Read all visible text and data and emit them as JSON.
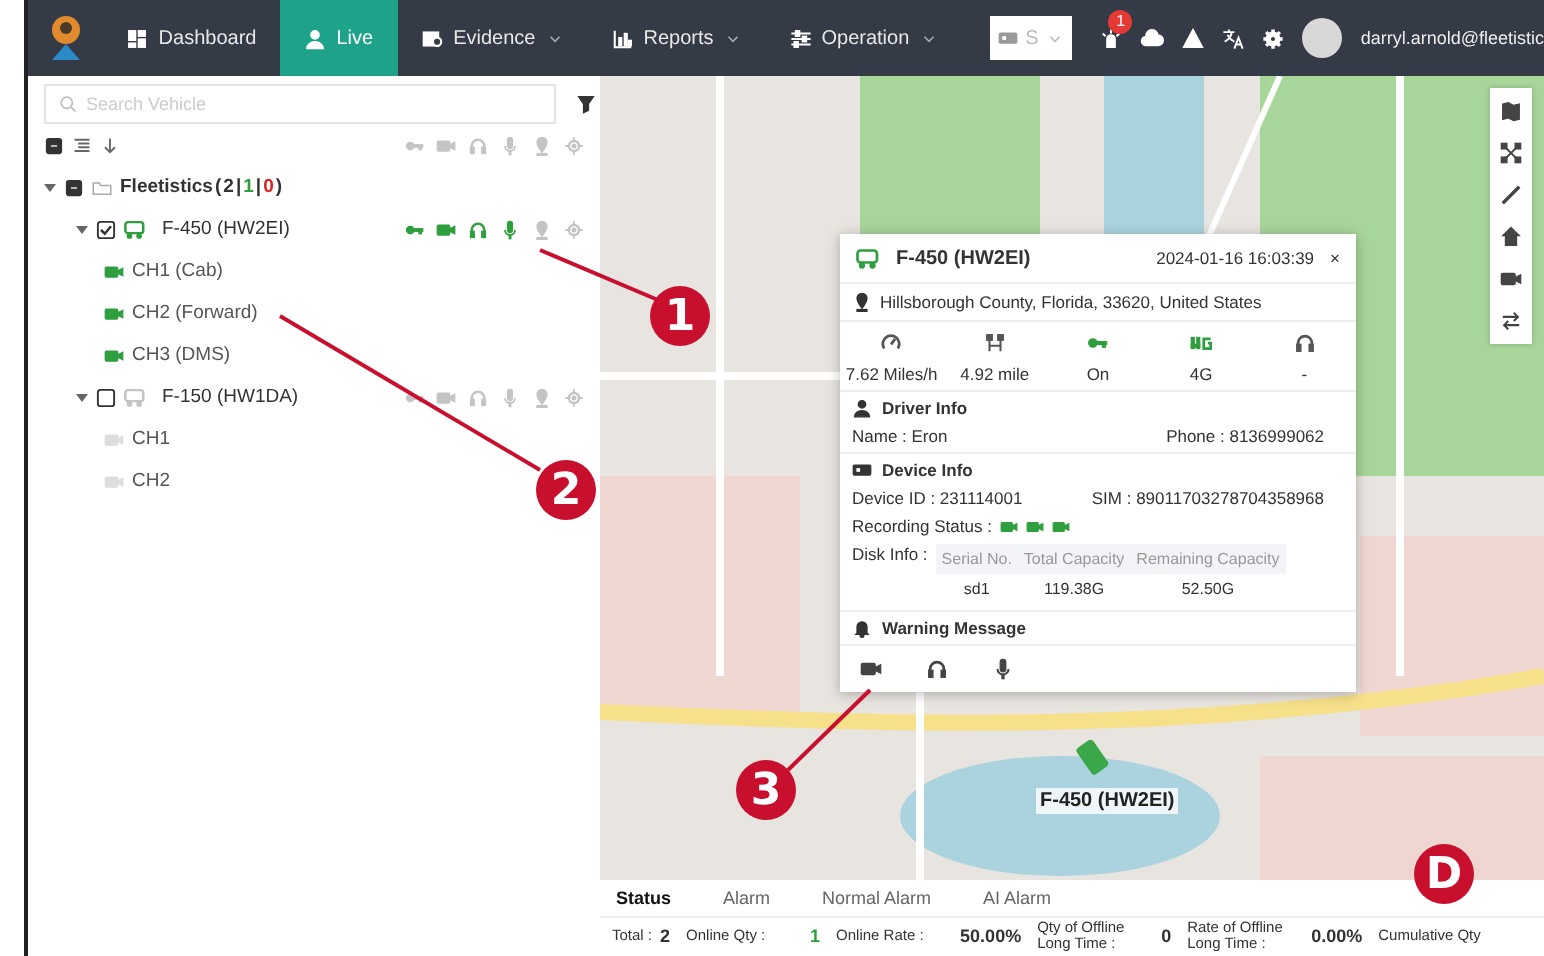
{
  "nav": {
    "items": [
      {
        "label": "Dashboard",
        "selected": false,
        "dropdown": false
      },
      {
        "label": "Live",
        "selected": true,
        "dropdown": false
      },
      {
        "label": "Evidence",
        "selected": false,
        "dropdown": true
      },
      {
        "label": "Reports",
        "selected": false,
        "dropdown": true
      },
      {
        "label": "Operation",
        "selected": false,
        "dropdown": true
      }
    ],
    "select_value": "S",
    "notification_count": "1",
    "user": "darryl.arnold@fleetistic"
  },
  "sidebar": {
    "search": {
      "placeholder": "Search Vehicle"
    },
    "group": {
      "label": "Fleetistics",
      "expanded": true,
      "indeterminate": true,
      "count_parts": [
        {
          "text": "(",
          "color": "#333333"
        },
        {
          "text": "2",
          "color": "#333333"
        },
        {
          "text": "|",
          "color": "#333333"
        },
        {
          "text": "1",
          "color": "#2e9e3e"
        },
        {
          "text": "|",
          "color": "#333333"
        },
        {
          "text": "0",
          "color": "#e02020"
        },
        {
          "text": ")",
          "color": "#333333"
        }
      ],
      "vehicles": [
        {
          "name": "F-450 (HW2EI)",
          "online": true,
          "checked": true,
          "expanded": true,
          "channels": [
            {
              "label": "CH1 (Cab)",
              "online": true
            },
            {
              "label": "CH2 (Forward)",
              "online": true
            },
            {
              "label": "CH3 (DMS)",
              "online": true
            }
          ]
        },
        {
          "name": "F-150 (HW1DA)",
          "online": false,
          "checked": false,
          "expanded": true,
          "channels": [
            {
              "label": "CH1",
              "online": false
            },
            {
              "label": "CH2",
              "online": false
            }
          ]
        }
      ]
    }
  },
  "popup": {
    "title": "F-450 (HW2EI)",
    "time": "2024-01-16 16:03:39",
    "close": "×",
    "address": "Hillsborough County, Florida, 33620, United States",
    "stats": [
      {
        "value": "7.62 Miles/h",
        "active": false
      },
      {
        "value": "4.92 mile",
        "active": false
      },
      {
        "value": "On",
        "active": true
      },
      {
        "value": "4G",
        "active": true
      },
      {
        "value": "-",
        "active": false
      }
    ],
    "driver": {
      "heading": "Driver Info",
      "name": "Name : Eron",
      "phone": "Phone : 8136999062"
    },
    "device": {
      "heading": "Device Info",
      "id": "Device ID : 231114001",
      "sim": "SIM : 89011703278704358968",
      "recording_label": "Recording Status :",
      "recording": [
        {
          "on": true
        },
        {
          "on": true
        },
        {
          "on": true
        }
      ],
      "disk_label": "Disk Info :",
      "disk_columns": [
        "Serial No.",
        "Total Capacity",
        "Remaining Capacity"
      ],
      "disk_rows": [
        [
          "sd1",
          "119.38G",
          "52.50G"
        ]
      ]
    },
    "warning_heading": "Warning Message"
  },
  "map": {
    "vehicle_label": "F-450 (HW2EI)"
  },
  "callouts": [
    "1",
    "2",
    "3",
    "D"
  ],
  "bottom": {
    "tabs": [
      {
        "label": "Status",
        "selected": true
      },
      {
        "label": "Alarm",
        "selected": false
      },
      {
        "label": "Normal Alarm",
        "selected": false
      },
      {
        "label": "AI Alarm",
        "selected": false
      }
    ],
    "stats": [
      {
        "label": "Total :",
        "value": "2"
      },
      {
        "label": "Online Qty :",
        "value": "1",
        "color": "#2e9e3e"
      },
      {
        "label": "Online Rate :",
        "value": "50.00%"
      },
      {
        "label": "Qty of Offline Long Time :",
        "value": "0"
      },
      {
        "label": "Rate of Offline Long Time :",
        "value": "0.00%"
      },
      {
        "label": "Cumulative Qty"
      }
    ]
  }
}
